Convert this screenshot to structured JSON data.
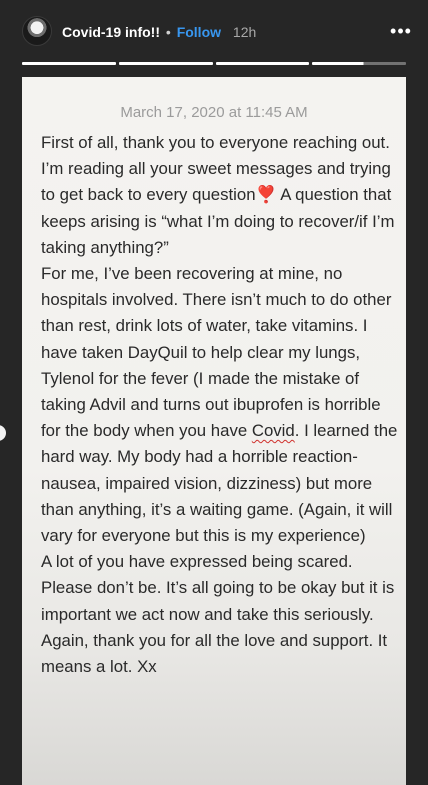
{
  "header": {
    "username": "Covid-19 info!!",
    "separator": "•",
    "follow_label": "Follow",
    "time": "12h",
    "more_icon": "more-dots-icon",
    "more_label": "•••"
  },
  "story": {
    "segments_total": 4,
    "segments_complete": 3,
    "current_segment_progress": 0.55
  },
  "note": {
    "date": "March 17, 2020 at 11:45 AM",
    "p1_a": "First of all, thank you to everyone reaching out. I’m reading all your sweet messages and trying to get back to every question",
    "heart": "❣️",
    "p1_b": " A question that keeps arising is “what I’m doing to recover/if I’m taking anything?”",
    "p2_a": "For me, I’ve been recovering at mine, no hospitals involved. There isn’t much to do other than rest, drink lots of water, take vitamins. I have taken DayQuil to help clear my lungs, Tylenol for the fever (I made the mistake of taking Advil and turns out ibuprofen is horrible for the body when you have ",
    "p2_word": "Covid",
    "p2_b": ". I learned the hard way. My body had a horrible reaction- nausea, impaired vision, dizziness) but more than anything, it’s a waiting game. (Again, it will vary for everyone but this is my experience)",
    "p3": "A lot of you have expressed being scared. Please don’t be. It’s all going to be okay but it is important we act now and take this seriously. Again, thank you for all the love and support. It means a lot. Xx"
  }
}
